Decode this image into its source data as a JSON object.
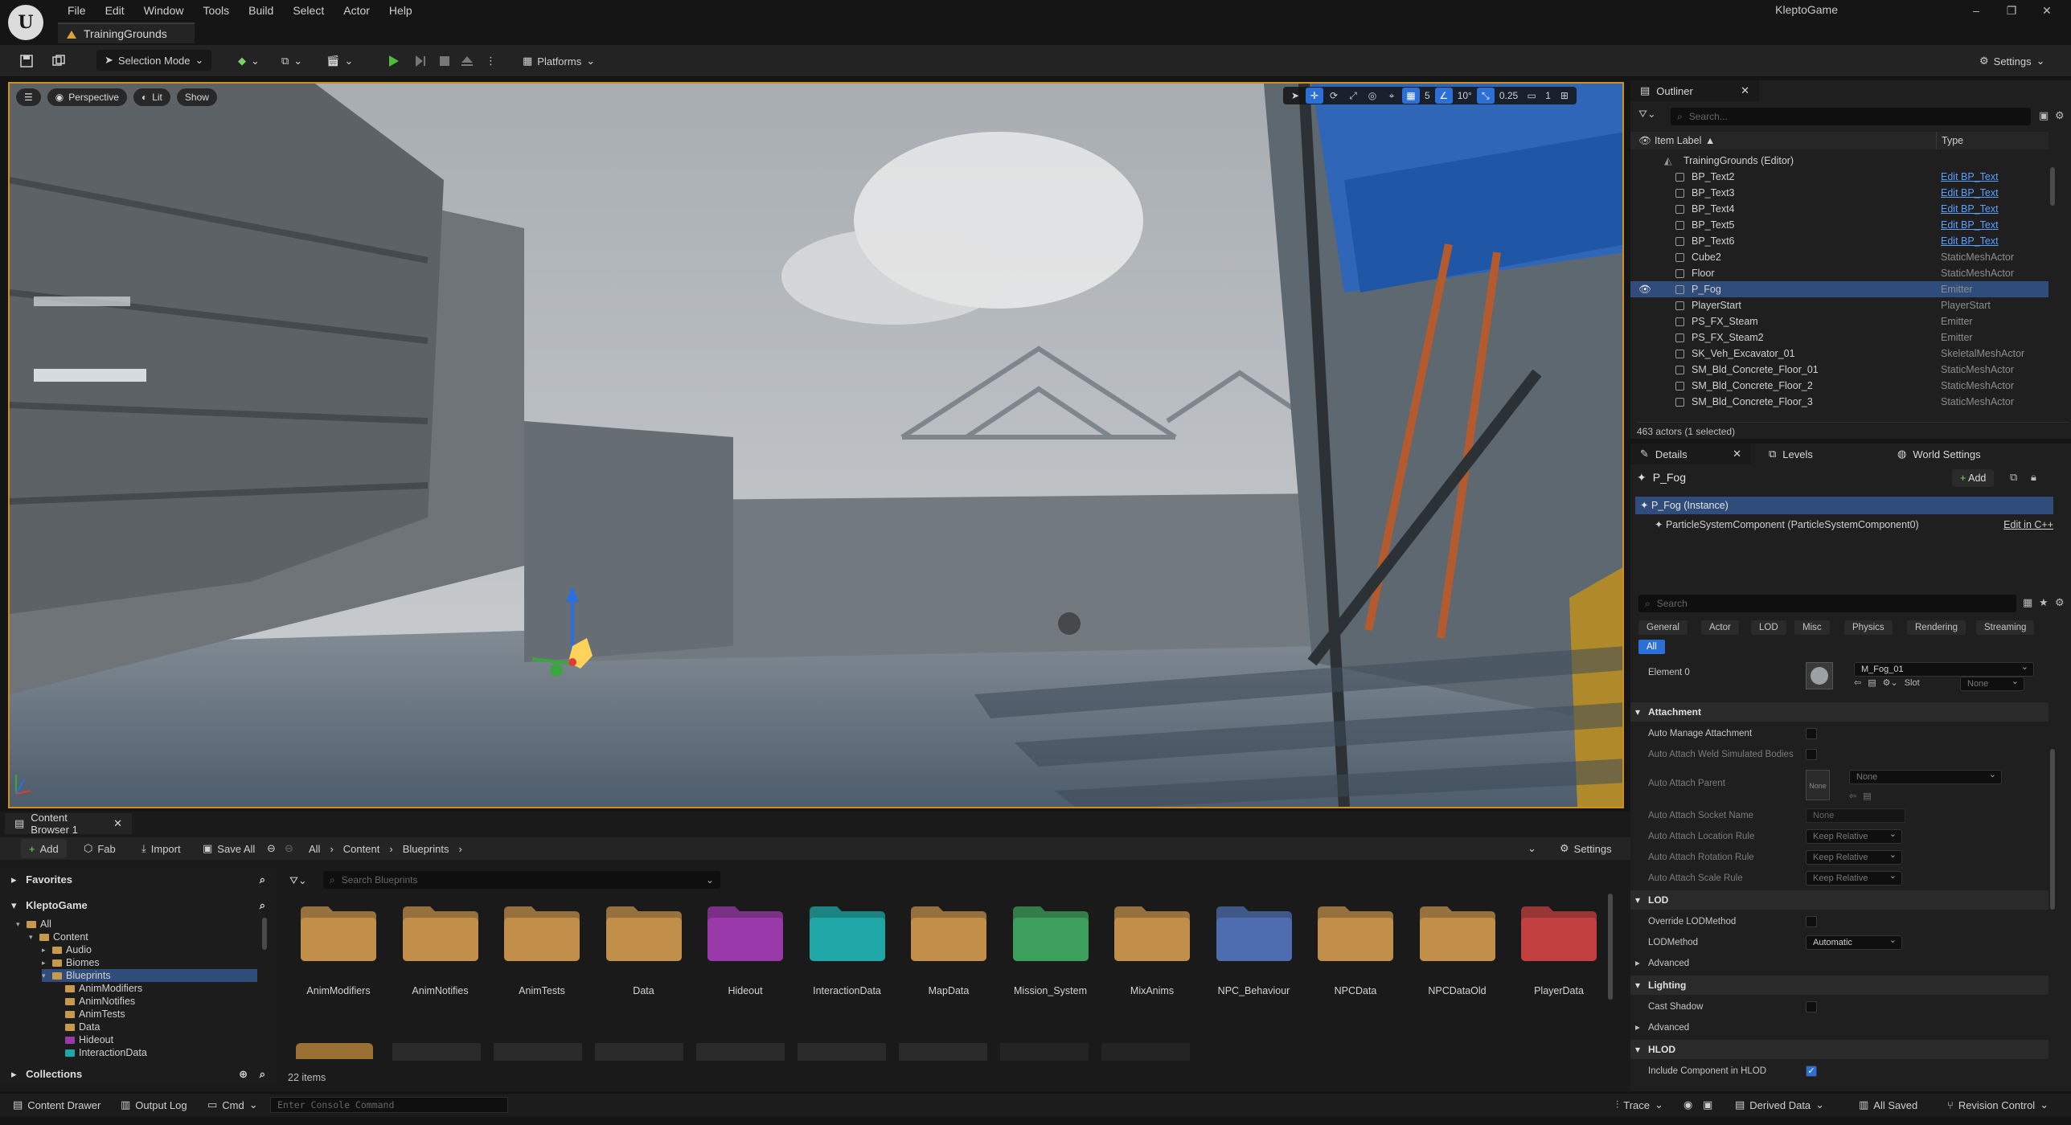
{
  "app": {
    "title": "KleptoGame",
    "logo_letter": "U"
  },
  "menu": [
    "File",
    "Edit",
    "Window",
    "Tools",
    "Build",
    "Select",
    "Actor",
    "Help"
  ],
  "document_tab": "TrainingGrounds",
  "toolbar": {
    "selection_mode": "Selection Mode",
    "platforms": "Platforms",
    "settings": "Settings"
  },
  "viewport": {
    "perspective": "Perspective",
    "lit": "Lit",
    "show": "Show",
    "grid_size": "5",
    "rotation_snap": "10°",
    "scale_snap": "0.25",
    "camera_speed": "1"
  },
  "outliner": {
    "tab": "Outliner",
    "search_placeholder": "Search...",
    "col_label": "Item Label",
    "col_type": "Type",
    "world": "TrainingGrounds (Editor)",
    "rows": [
      {
        "label": "BP_Text2",
        "type": "Edit BP_Text",
        "link": true
      },
      {
        "label": "BP_Text3",
        "type": "Edit BP_Text",
        "link": true
      },
      {
        "label": "BP_Text4",
        "type": "Edit BP_Text",
        "link": true
      },
      {
        "label": "BP_Text5",
        "type": "Edit BP_Text",
        "link": true
      },
      {
        "label": "BP_Text6",
        "type": "Edit BP_Text",
        "link": true
      },
      {
        "label": "Cube2",
        "type": "StaticMeshActor",
        "link": false
      },
      {
        "label": "Floor",
        "type": "StaticMeshActor",
        "link": false
      },
      {
        "label": "P_Fog",
        "type": "Emitter",
        "link": false,
        "selected": true
      },
      {
        "label": "PlayerStart",
        "type": "PlayerStart",
        "link": false
      },
      {
        "label": "PS_FX_Steam",
        "type": "Emitter",
        "link": false
      },
      {
        "label": "PS_FX_Steam2",
        "type": "Emitter",
        "link": false
      },
      {
        "label": "SK_Veh_Excavator_01",
        "type": "SkeletalMeshActor",
        "link": false
      },
      {
        "label": "SM_Bld_Concrete_Floor_01",
        "type": "StaticMeshActor",
        "link": false
      },
      {
        "label": "SM_Bld_Concrete_Floor_2",
        "type": "StaticMeshActor",
        "link": false
      },
      {
        "label": "SM_Bld_Concrete_Floor_3",
        "type": "StaticMeshActor",
        "link": false
      }
    ],
    "footer": "463 actors (1 selected)"
  },
  "details": {
    "tabs": [
      "Details",
      "Levels",
      "World Settings"
    ],
    "actor_name": "P_Fog",
    "add_label": "Add",
    "instance": "P_Fog (Instance)",
    "component": "ParticleSystemComponent (ParticleSystemComponent0)",
    "edit_cpp": "Edit in C++",
    "search_placeholder": "Search",
    "categories": [
      "General",
      "Actor",
      "LOD",
      "Misc",
      "Physics",
      "Rendering",
      "Streaming"
    ],
    "all_label": "All",
    "element0_label": "Element 0",
    "element0_value": "M_Fog_01",
    "slot_label": "Slot",
    "slot_value": "None",
    "attachment": {
      "header": "Attachment",
      "auto_manage": "Auto Manage Attachment",
      "auto_weld": "Auto Attach Weld Simulated Bodies",
      "auto_parent": "Auto Attach Parent",
      "auto_parent_value": "None",
      "auto_parent_thumb": "None",
      "socket": "Auto Attach Socket Name",
      "socket_value": "None",
      "loc_rule": "Auto Attach Location Rule",
      "rot_rule": "Auto Attach Rotation Rule",
      "scale_rule": "Auto Attach Scale Rule",
      "rule_value": "Keep Relative"
    },
    "lod": {
      "header": "LOD",
      "override": "Override LODMethod",
      "method": "LODMethod",
      "method_value": "Automatic",
      "advanced": "Advanced"
    },
    "lighting": {
      "header": "Lighting",
      "cast_shadow": "Cast Shadow",
      "advanced": "Advanced"
    },
    "hlod": {
      "header": "HLOD",
      "include": "Include Component in HLOD"
    }
  },
  "content_browser": {
    "tab": "Content Browser 1",
    "add": "Add",
    "fab": "Fab",
    "import": "Import",
    "save_all": "Save All",
    "path": [
      "All",
      "Content",
      "Blueprints"
    ],
    "settings": "Settings",
    "favorites": "Favorites",
    "project": "KleptoGame",
    "collections": "Collections",
    "search_placeholder": "Search Blueprints",
    "items_count": "22 items",
    "tree": [
      {
        "label": "All",
        "depth": 0,
        "type": "all"
      },
      {
        "label": "Content",
        "depth": 1,
        "type": "folder"
      },
      {
        "label": "Audio",
        "depth": 2,
        "type": "folder"
      },
      {
        "label": "Biomes",
        "depth": 2,
        "type": "folder"
      },
      {
        "label": "Blueprints",
        "depth": 2,
        "type": "folder",
        "selected": true
      },
      {
        "label": "AnimModifiers",
        "depth": 3,
        "type": "folder"
      },
      {
        "label": "AnimNotifies",
        "depth": 3,
        "type": "folder"
      },
      {
        "label": "AnimTests",
        "depth": 3,
        "type": "folder"
      },
      {
        "label": "Data",
        "depth": 3,
        "type": "folder"
      },
      {
        "label": "Hideout",
        "depth": 3,
        "type": "folder"
      },
      {
        "label": "InteractionData",
        "depth": 3,
        "type": "folder"
      }
    ],
    "folders": [
      {
        "name": "AnimModifiers",
        "color": "#c18f4a"
      },
      {
        "name": "AnimNotifies",
        "color": "#c18f4a"
      },
      {
        "name": "AnimTests",
        "color": "#c18f4a"
      },
      {
        "name": "Data",
        "color": "#c18f4a"
      },
      {
        "name": "Hideout",
        "color": "#9a3aaa"
      },
      {
        "name": "InteractionData",
        "color": "#1fa6a6"
      },
      {
        "name": "MapData",
        "color": "#c18f4a"
      },
      {
        "name": "Mission_System",
        "color": "#3d9f5c"
      },
      {
        "name": "MixAnims",
        "color": "#c18f4a"
      },
      {
        "name": "NPC_Behaviour",
        "color": "#4e6cb0"
      },
      {
        "name": "NPCData",
        "color": "#c18f4a"
      },
      {
        "name": "NPCDataOld",
        "color": "#c18f4a"
      },
      {
        "name": "PlayerData",
        "color": "#c2403f"
      }
    ]
  },
  "statusbar": {
    "content_drawer": "Content Drawer",
    "output_log": "Output Log",
    "cmd": "Cmd",
    "console_placeholder": "Enter Console Command",
    "trace": "Trace",
    "derived_data": "Derived Data",
    "all_saved": "All Saved",
    "revision_control": "Revision Control"
  }
}
